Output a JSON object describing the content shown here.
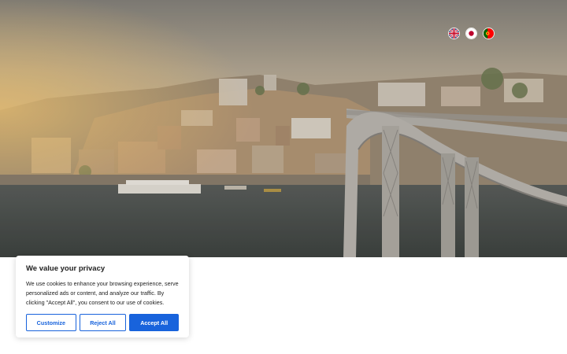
{
  "hero": {
    "image": "porto-city-bridge-photo"
  },
  "languages": [
    {
      "code": "en",
      "icon": "uk-flag-icon"
    },
    {
      "code": "ja",
      "icon": "japan-flag-icon"
    },
    {
      "code": "pt",
      "icon": "portugal-flag-icon"
    }
  ],
  "cookie": {
    "title": "We value your privacy",
    "text": "We use cookies to enhance your browsing experience, serve personalized ads or content, and analyze our traffic. By clicking \"Accept All\", you consent to our use of cookies.",
    "customize_label": "Customize",
    "reject_label": "Reject All",
    "accept_label": "Accept All"
  },
  "colors": {
    "accent": "#1863dc",
    "text": "#212121"
  }
}
